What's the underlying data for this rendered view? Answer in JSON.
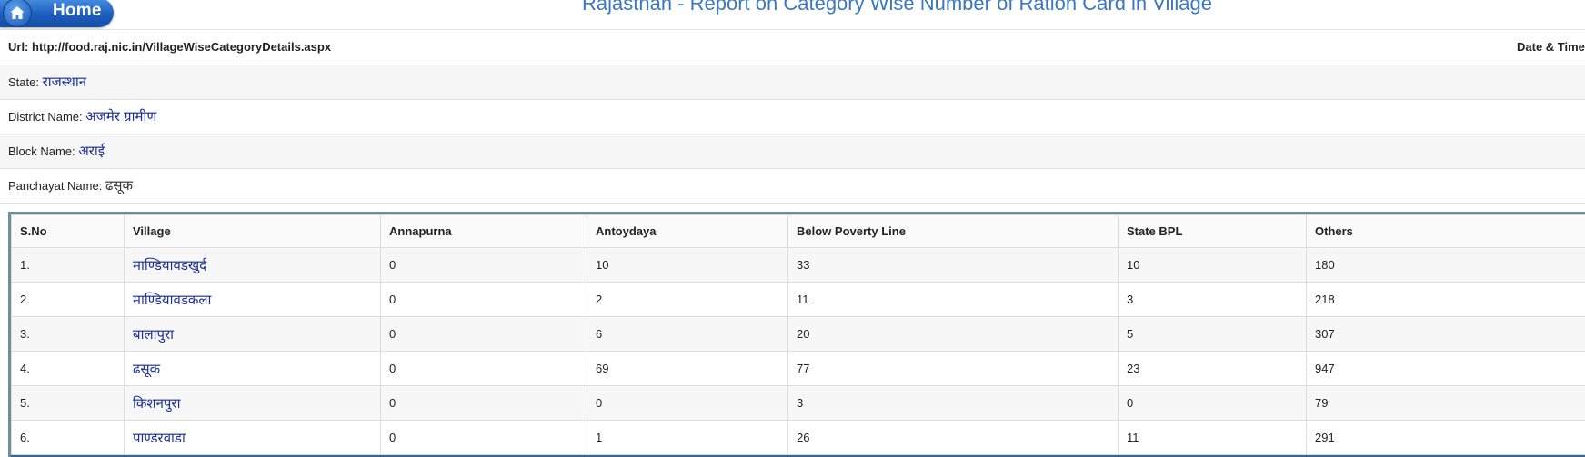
{
  "header": {
    "home_label": "Home",
    "title": "Rajasthan - Report on Category Wise Number of Ration Card in Village"
  },
  "info": {
    "url_label": "Url:",
    "url_value": "http://food.raj.nic.in/VillageWiseCategoryDetails.aspx",
    "datetime_label": "Date & Time",
    "state_label": "State:",
    "state_value": "राजस्थान",
    "district_label": "District Name:",
    "district_value": "अजमेर ग्रामीण",
    "block_label": "Block Name:",
    "block_value": "अराई",
    "panchayat_label": "Panchayat Name:",
    "panchayat_value": "ढसूक"
  },
  "table": {
    "headers": [
      "S.No",
      "Village",
      "Annapurna",
      "Antoydaya",
      "Below Poverty Line",
      "State BPL",
      "Others"
    ],
    "rows": [
      {
        "sno": "1.",
        "village": "माण्डियावडखुर्द",
        "annapurna": "0",
        "antoydaya": "10",
        "bpl": "33",
        "state_bpl": "10",
        "others": "180"
      },
      {
        "sno": "2.",
        "village": "माण्डियावडकला",
        "annapurna": "0",
        "antoydaya": "2",
        "bpl": "11",
        "state_bpl": "3",
        "others": "218"
      },
      {
        "sno": "3.",
        "village": "बालापुरा",
        "annapurna": "0",
        "antoydaya": "6",
        "bpl": "20",
        "state_bpl": "5",
        "others": "307"
      },
      {
        "sno": "4.",
        "village": "ढसूक",
        "annapurna": "0",
        "antoydaya": "69",
        "bpl": "77",
        "state_bpl": "23",
        "others": "947"
      },
      {
        "sno": "5.",
        "village": "किशनपुरा",
        "annapurna": "0",
        "antoydaya": "0",
        "bpl": "3",
        "state_bpl": "0",
        "others": "79"
      },
      {
        "sno": "6.",
        "village": "पाण्डरवाडा",
        "annapurna": "0",
        "antoydaya": "1",
        "bpl": "26",
        "state_bpl": "11",
        "others": "291"
      }
    ]
  },
  "colors": {
    "title": "#3a78c4",
    "link": "#1a2e9a",
    "footer_bar": "#336699",
    "table_border": "#6c8f9a"
  }
}
